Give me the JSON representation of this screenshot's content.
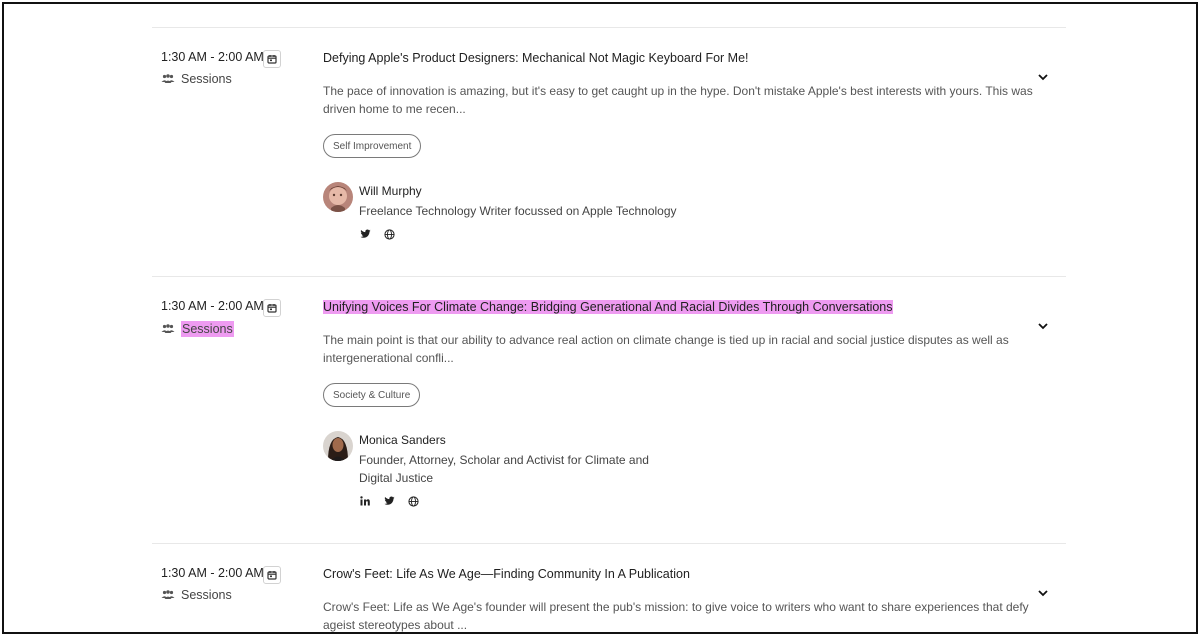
{
  "sessions": [
    {
      "time": "1:30 AM - 2:00 AM",
      "type": "Sessions",
      "title": "Defying Apple's Product Designers: Mechanical Not Magic Keyboard For Me!",
      "description": "The pace of innovation is amazing, but it's easy to get caught up in the hype. Don't mistake Apple's best interests with yours. This was driven home to me recen...",
      "tag": "Self Improvement",
      "speaker": {
        "name": "Will Murphy",
        "role": "Freelance Technology Writer focussed on Apple Technology"
      },
      "socials": [
        "twitter-icon",
        "globe-icon"
      ],
      "highlighted": false
    },
    {
      "time": "1:30 AM - 2:00 AM",
      "type": "Sessions",
      "title": "Unifying Voices For Climate Change: Bridging Generational And Racial Divides Through Conversations",
      "description": "The main point is that our ability to advance real action on climate change is tied up in racial and social justice disputes as well as intergenera­tional confli...",
      "tag": "Society & Culture",
      "speaker": {
        "name": "Monica Sanders",
        "role": "Founder, Attorney, Scholar and Activist for Climate and Digital Justice"
      },
      "socials": [
        "linkedin-icon",
        "twitter-icon",
        "globe-icon"
      ],
      "highlighted": true,
      "highlight_color": "#ee9bf1"
    },
    {
      "time": "1:30 AM - 2:00 AM",
      "type": "Sessions",
      "title": "Crow's Feet: Life As We Age—Finding Community In A Publication",
      "description": "Crow's Feet: Life as We Age's founder will present the pub's mission: to give voice to writers who want to share experiences that defy ageist stereotypes about ...",
      "highlighted": false
    }
  ]
}
